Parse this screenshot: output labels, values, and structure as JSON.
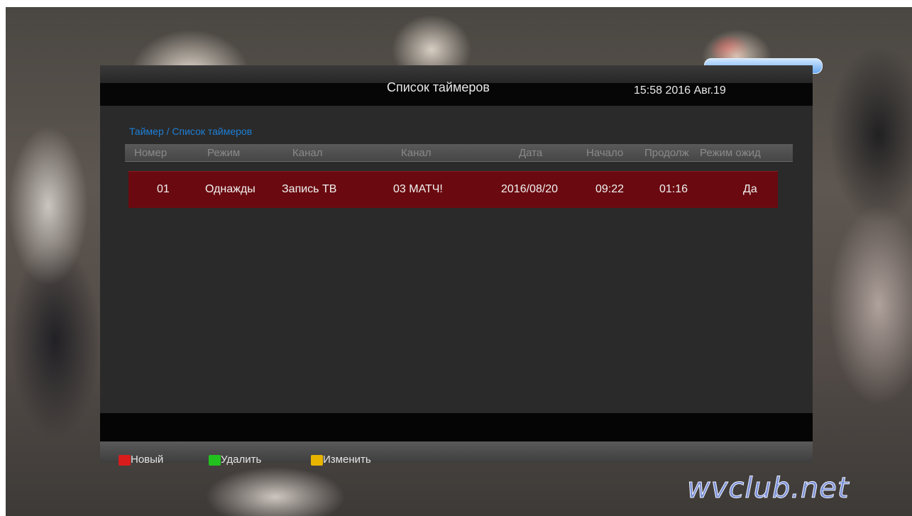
{
  "header": {
    "title": "Список таймеров",
    "clock": "15:58 2016 Авг.19"
  },
  "breadcrumb": "Таймер / Список таймеров",
  "table": {
    "columns": [
      "Номер",
      "Режим",
      "Канал",
      "Канал",
      "Дата",
      "Начало",
      "Продолж",
      "Режим ожид"
    ],
    "rows": [
      [
        "01",
        "Однажды",
        "Запись ТВ",
        "03 МАТЧ!",
        "2016/08/20",
        "09:22",
        "01:16",
        "Да"
      ]
    ]
  },
  "legend": {
    "new_label": "Новый",
    "delete_label": "Удалить",
    "edit_label": "Изменить",
    "colors": {
      "red": "#d81c1c",
      "green": "#22c21e",
      "yellow": "#e8b400"
    }
  },
  "watermark": "wvclub.net"
}
